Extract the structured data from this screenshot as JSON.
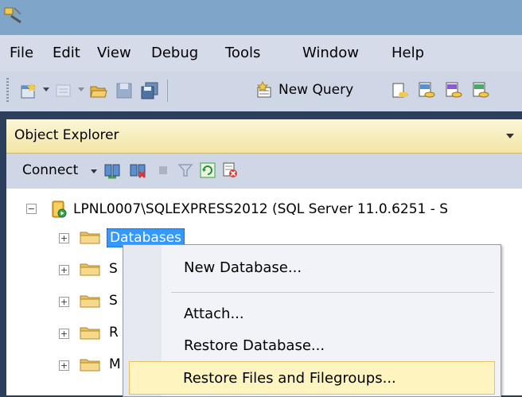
{
  "menubar": {
    "items": [
      "File",
      "Edit",
      "View",
      "Debug",
      "Tools",
      "Window",
      "Help"
    ]
  },
  "toolbar": {
    "new_query_label": "New Query"
  },
  "object_explorer": {
    "title": "Object Explorer",
    "connect_label": "Connect",
    "server_label": "LPNL0007\\SQLEXPRESS2012 (SQL Server 11.0.6251 - S",
    "nodes": [
      "Databases",
      "S",
      "S",
      "R",
      "M"
    ]
  },
  "context_menu": {
    "items": [
      "New Database...",
      "Attach...",
      "Restore Database...",
      "Restore Files and Filegroups..."
    ]
  },
  "colors": {
    "selection": "#3399ff",
    "highlight": "#fdf4bf",
    "titlebar": "#7fa6c9"
  }
}
